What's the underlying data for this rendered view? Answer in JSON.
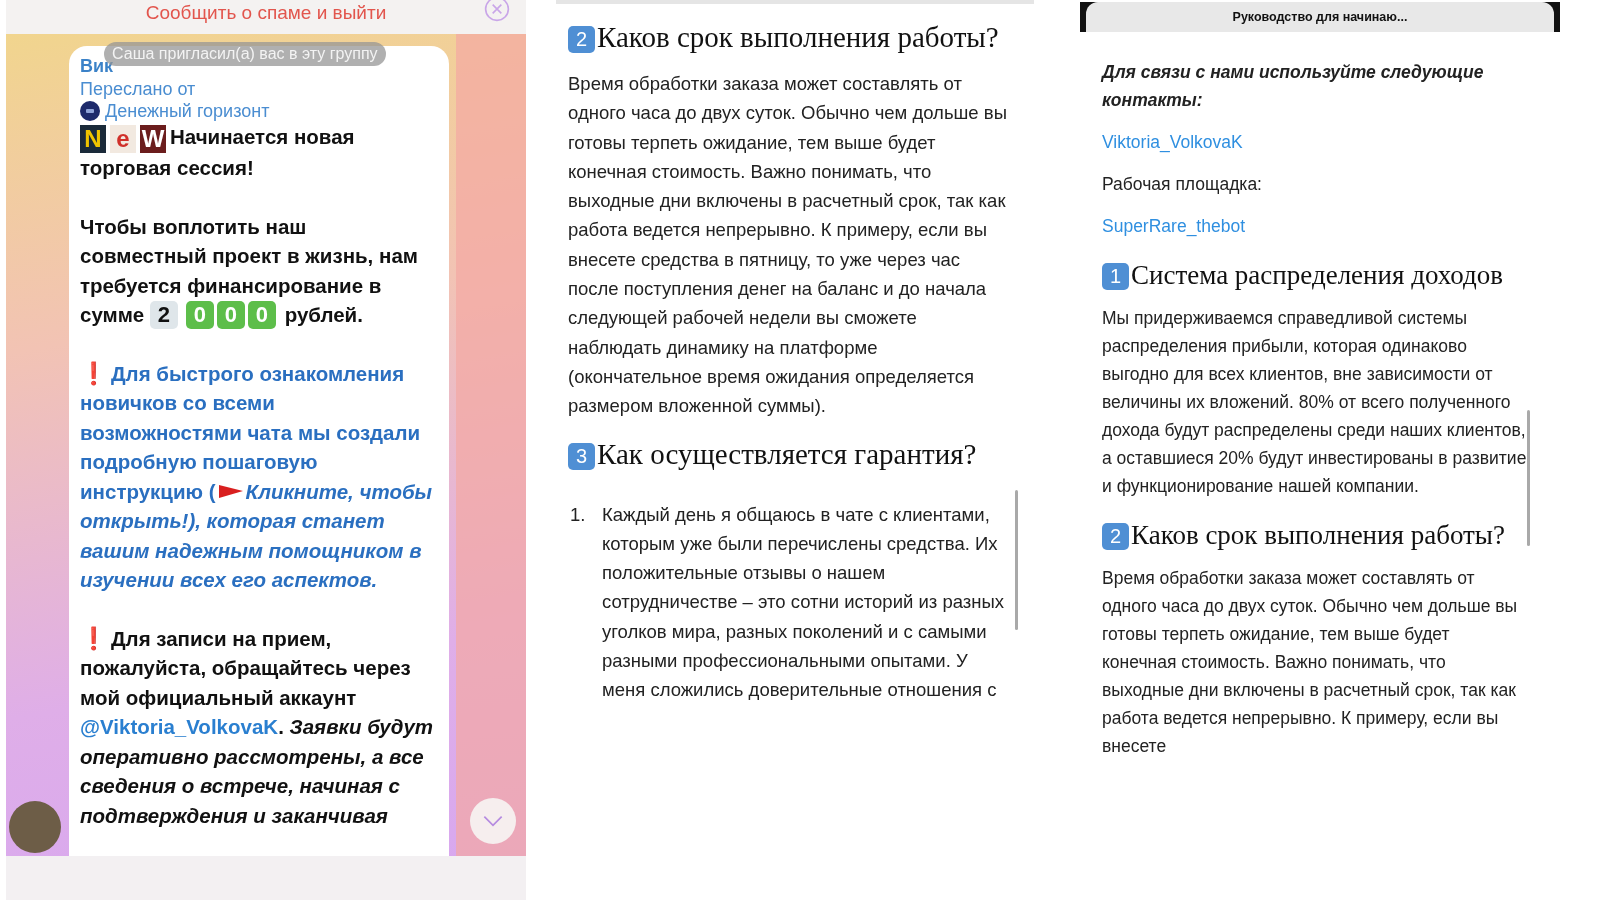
{
  "chat": {
    "spam_bar": "Сообщить о спаме и выйти",
    "invite_notice": "Саша пригласил(а) вас в эту группу",
    "message": {
      "sender": "Вик",
      "forwarded_label": "Переслано от",
      "channel": "Денежный горизонт",
      "new_badge": [
        "N",
        "e",
        "W"
      ],
      "headline": "Начинается новая торговая сессия!",
      "paragraphs": [
        [
          {
            "kind": "plain",
            "text": "Чтобы воплотить наш совместный проект в жизнь, нам требуется финансирование в сумме "
          },
          {
            "kind": "digits",
            "tiles": [
              "2",
              "0",
              "0",
              "0"
            ]
          },
          {
            "kind": "plain",
            "text": " рублей."
          }
        ],
        [
          {
            "kind": "alert",
            "text": "❗"
          },
          {
            "kind": "link",
            "text": "Для быстрого ознакомления новичков со всеми возможностями чата мы создали подробную пошаговую инструкцию ("
          },
          {
            "kind": "flag"
          },
          {
            "kind": "link_italic",
            "text": "Кликните, чтобы открыть!), которая станет вашим надежным помощником в изучении всех его аспектов."
          }
        ],
        [
          {
            "kind": "alert",
            "text": "❗"
          },
          {
            "kind": "plain",
            "text": "Для записи на прием, пожалуйста, обращайтесь через мой официальный аккаунт "
          },
          {
            "kind": "mention",
            "text": "@Viktoria_VolkovaK"
          },
          {
            "kind": "plain",
            "text": ". "
          },
          {
            "kind": "italic",
            "text": "Заявки будут оперативно рассмотрены, а все сведения о встрече, начиная с подтверждения и заканчивая"
          }
        ]
      ]
    }
  },
  "article": [
    {
      "kind": "heading",
      "number": "2",
      "text": "Каков срок выполнения работы?"
    },
    {
      "kind": "paragraph",
      "text": "Время обработки заказа может составлять от одного часа до двух суток. Обычно чем дольше вы готовы терпеть ожидание, тем выше будет конечная стоимость. Важно понимать, что выходные дни включены в расчетный срок, так как работа ведется непрерывно. К примеру, если вы внесете средства в пятницу, то уже через час после поступления денег на баланс и до начала следующей рабочей недели вы сможете наблюдать динамику на платформе (окончательное время ожидания определяется размером вложенной суммы)."
    },
    {
      "kind": "heading",
      "number": "3",
      "text": "Как осуществляется гарантия?"
    },
    {
      "kind": "list_item",
      "marker": "1.",
      "text": "Каждый день я общаюсь в чате с клиентами, которым уже были перечислены средства. Их положительные отзывы о нашем сотрудничестве – это сотни историй из разных уголков мира, разных поколений и с самыми разными профессиональными опытами. У меня сложились доверительные отношения с"
    }
  ],
  "guide": {
    "title": "Руководство для начинаю...",
    "blocks": [
      {
        "kind": "emphasis",
        "text": "Для связи с нами используйте следующие контакты:"
      },
      {
        "kind": "link",
        "text": "Viktoria_VolkovaK"
      },
      {
        "kind": "paragraph",
        "text": "Рабочая площадка:"
      },
      {
        "kind": "link",
        "text": "SuperRare_thebot"
      },
      {
        "kind": "heading",
        "number": "1",
        "text": "Система распределения доходов"
      },
      {
        "kind": "paragraph",
        "text": "Мы придерживаемся справедливой системы распределения прибыли, которая одинаково выгодно для всех клиентов, вне зависимости от величины их вложений. 80% от всего полученного дохода будут распределены среди наших клиентов, а оставшиеся 20% будут инвестированы в развитие и функционирование нашей компании."
      },
      {
        "kind": "heading",
        "number": "2",
        "text": "Каков срок выполнения работы?"
      },
      {
        "kind": "paragraph",
        "text": "Время обработки заказа может составлять от одного часа до двух суток. Обычно чем дольше вы готовы терпеть ожидание, тем выше будет конечная стоимость. Важно понимать, что выходные дни включены в расчетный срок, так как работа ведется непрерывно. К примеру, если вы внесете"
      }
    ]
  }
}
